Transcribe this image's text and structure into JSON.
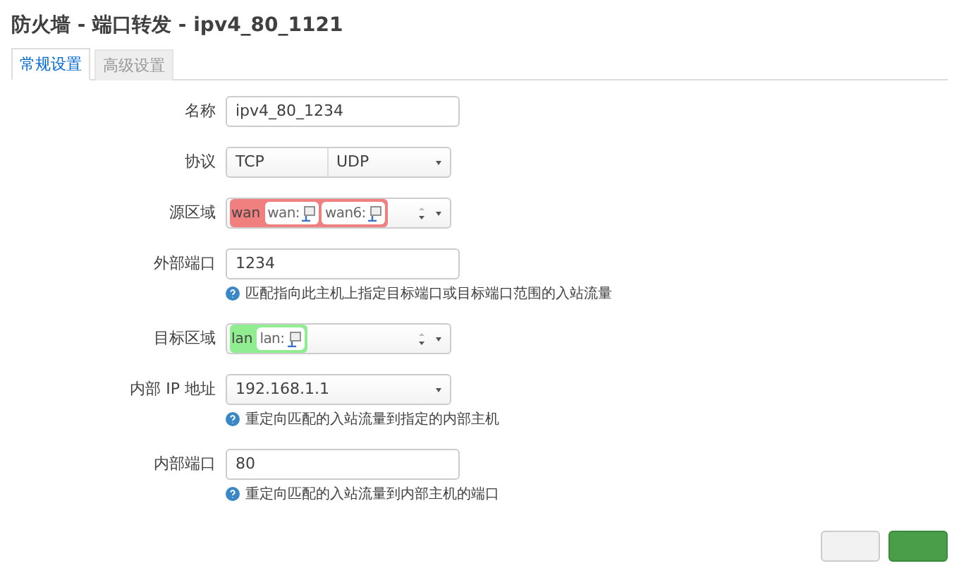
{
  "title": "防火墙 - 端口转发 - ipv4_80_1121",
  "tabs": [
    {
      "label": "常规设置",
      "selected": true
    },
    {
      "label": "高级设置",
      "selected": false
    }
  ],
  "fields": [
    {
      "kind": "text",
      "label": "名称",
      "value": "ipv4_80_1234"
    },
    {
      "kind": "multi",
      "label": "协议",
      "values": [
        "TCP",
        "UDP"
      ]
    },
    {
      "kind": "zone",
      "label": "源区域",
      "zone": {
        "name": "wan",
        "color": "#f08080",
        "networks": [
          "wan:",
          "wan6:"
        ]
      }
    },
    {
      "kind": "text",
      "label": "外部端口",
      "value": "1234",
      "help": "匹配指向此主机上指定目标端口或目标端口范围的入站流量"
    },
    {
      "kind": "zone",
      "label": "目标区域",
      "zone": {
        "name": "lan",
        "color": "#90ee90",
        "networks": [
          "lan:"
        ]
      }
    },
    {
      "kind": "select",
      "label": "内部 IP 地址",
      "value": "192.168.1.1",
      "help": "重定向匹配的入站流量到指定的内部主机"
    },
    {
      "kind": "text",
      "label": "内部端口",
      "value": "80",
      "help": "重定向匹配的入站流量到内部主机的端口"
    }
  ],
  "buttons": [
    {
      "kind": "secondary"
    },
    {
      "kind": "primary"
    }
  ]
}
